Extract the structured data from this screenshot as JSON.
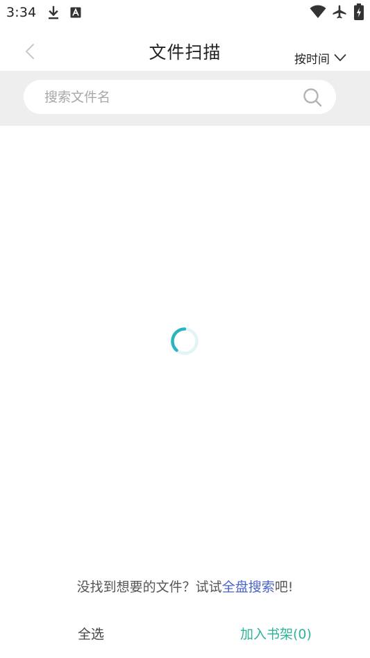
{
  "status_bar": {
    "time": "3:34",
    "icons": [
      "download-icon",
      "keyboard-a-icon",
      "wifi-icon",
      "airplane-icon",
      "battery-charging-icon"
    ]
  },
  "header": {
    "title": "文件扫描",
    "sort_label": "按时间",
    "sort_icon": "chevron-down-icon",
    "back_icon": "chevron-left-icon"
  },
  "search": {
    "placeholder": "搜索文件名",
    "value": "",
    "icon": "search-icon"
  },
  "loading": {
    "icon": "loading-spinner-icon",
    "colors": {
      "arc": "#2bb3c0",
      "track": "#e3f4f6"
    }
  },
  "hint": {
    "prefix": "没找到想要的文件？试试",
    "link": "全盘搜索",
    "suffix": "吧!"
  },
  "bottom_bar": {
    "select_all_label": "全选",
    "add_to_shelf_label": "加入书架(0)"
  },
  "colors": {
    "accent_green": "#2db39a",
    "link_blue": "#4a63c8",
    "band_gray": "#eeeeee"
  }
}
